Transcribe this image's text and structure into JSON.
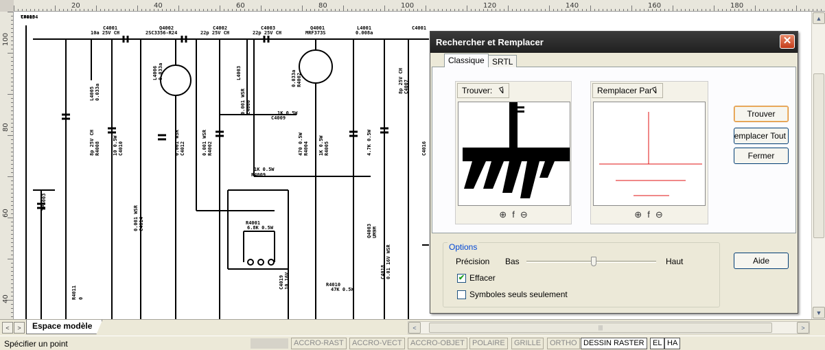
{
  "ruler": {
    "h_labels": [
      "20",
      "40",
      "60",
      "80",
      "100",
      "120",
      "140",
      "160",
      "180"
    ],
    "v_labels": [
      "100",
      "80",
      "60",
      "40"
    ]
  },
  "schematic_labels": [
    "C4001",
    "10a 25V CH",
    "Q4002",
    "2SC3356-R24",
    "C4002",
    "22p 25V CH",
    "C4003",
    "22p 25V CH",
    "Q4001",
    "MRF373S",
    "L4001",
    "0.008a",
    "C4001",
    "L4005",
    "0.033a",
    "L4006",
    "0.033a",
    "L4003",
    "0.033a",
    "R4002",
    "1K 0.5W",
    "C4009",
    "0.001 WSR",
    "C4006",
    "8p 25V CH",
    "C4007",
    "8p 25V CH",
    "R4008",
    "10 0.5W",
    "C4010",
    "0.001 WSR",
    "C4012",
    "0.001 WSR",
    "R4002",
    "470 0.5W",
    "R4004",
    "1K 0.5W",
    "R4005",
    "1K 0.5W",
    "R4009",
    "4.7K 0.5W",
    "C4016",
    "0.001 WSR",
    "C4014",
    "R4001",
    "6.8K 0.5W",
    "Q4003",
    "UM9M",
    "C4018",
    "0.01 16V WSR",
    "C4019",
    "10 16V",
    "R4010",
    "47K 0.5W",
    "R4011",
    "0",
    "TP4003",
    "TP4004",
    "C4015"
  ],
  "bottom_tabs": {
    "model_tab": "Espace modèle"
  },
  "statusbar": {
    "prompt": "Spécifier un point",
    "toggles": [
      "ACCRO-RAST",
      "ACCRO-VECT",
      "ACCRO-OBJET",
      "POLAIRE",
      "GRILLE",
      "ORTHO",
      "DESSIN RASTER",
      "EL",
      "HA"
    ],
    "active_toggles": [
      "DESSIN RASTER",
      "EL",
      "HA"
    ]
  },
  "dialog": {
    "title": "Rechercher et Remplacer",
    "close_label": "✕",
    "tabs": [
      "Classique",
      "SRTL"
    ],
    "find_label": "Trouver:",
    "replace_label": "Remplacer Par",
    "zoom_icons": [
      "⊕",
      "f",
      "⊖"
    ],
    "buttons": {
      "find": "Trouver",
      "replace_all": "Remplacer Tout",
      "close": "Fermer",
      "help": "Aide"
    },
    "options": {
      "title": "Options",
      "precision": "Précision",
      "low": "Bas",
      "high": "Haut",
      "precision_level": 0.52,
      "erase": "Effacer",
      "erase_checked": true,
      "symbols_only": "Symboles seuls seulement",
      "symbols_only_checked": false
    }
  },
  "colors": {
    "replace_symbol": "#e01010",
    "title_bar": "#2a2a2a",
    "close_button": "#d4502a"
  }
}
